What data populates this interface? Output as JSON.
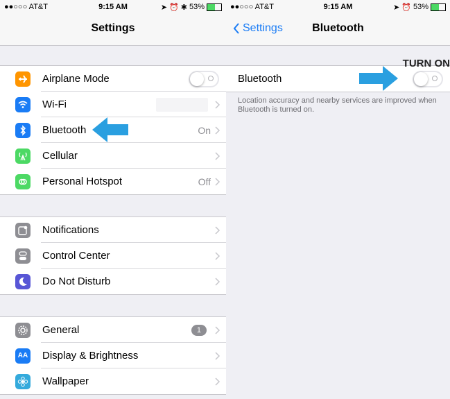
{
  "left": {
    "status": {
      "carrier": "●●○○○ AT&T",
      "time": "9:15 AM",
      "battery": "53%"
    },
    "nav_title": "Settings",
    "group1": [
      {
        "label": "Airplane Mode",
        "icon": "airplane-icon",
        "color": "#ff9500",
        "control": "toggle"
      },
      {
        "label": "Wi-Fi",
        "icon": "wifi-icon",
        "color": "#1a7cf5",
        "control": "chevron"
      },
      {
        "label": "Bluetooth",
        "icon": "bluetooth-icon",
        "color": "#1a7cf5",
        "value": "On",
        "control": "chevron"
      },
      {
        "label": "Cellular",
        "icon": "cellular-icon",
        "color": "#4cd964",
        "control": "chevron"
      },
      {
        "label": "Personal Hotspot",
        "icon": "hotspot-icon",
        "color": "#4cd964",
        "value": "Off",
        "control": "chevron"
      }
    ],
    "group2": [
      {
        "label": "Notifications",
        "icon": "notifications-icon",
        "color": "#8e8e93"
      },
      {
        "label": "Control Center",
        "icon": "control-center-icon",
        "color": "#8e8e93"
      },
      {
        "label": "Do Not Disturb",
        "icon": "moon-icon",
        "color": "#5856d6"
      }
    ],
    "group3": [
      {
        "label": "General",
        "icon": "gear-icon",
        "color": "#8e8e93",
        "badge": "1"
      },
      {
        "label": "Display & Brightness",
        "icon": "display-icon",
        "color": "#1a7cf5",
        "icon_text": "AA"
      },
      {
        "label": "Wallpaper",
        "icon": "wallpaper-icon",
        "color": "#34aadc"
      }
    ]
  },
  "right": {
    "status": {
      "carrier": "●●○○○ AT&T",
      "time": "9:15 AM",
      "battery": "53%"
    },
    "back_label": "Settings",
    "nav_title": "Bluetooth",
    "bluetooth_label": "Bluetooth",
    "note": "Location accuracy and nearby services are improved when Bluetooth is turned on.",
    "annotation": "TURN ON"
  },
  "colors": {
    "accent": "#1a7cf5",
    "arrow": "#2a9fe0",
    "battery": "#4cd964"
  }
}
